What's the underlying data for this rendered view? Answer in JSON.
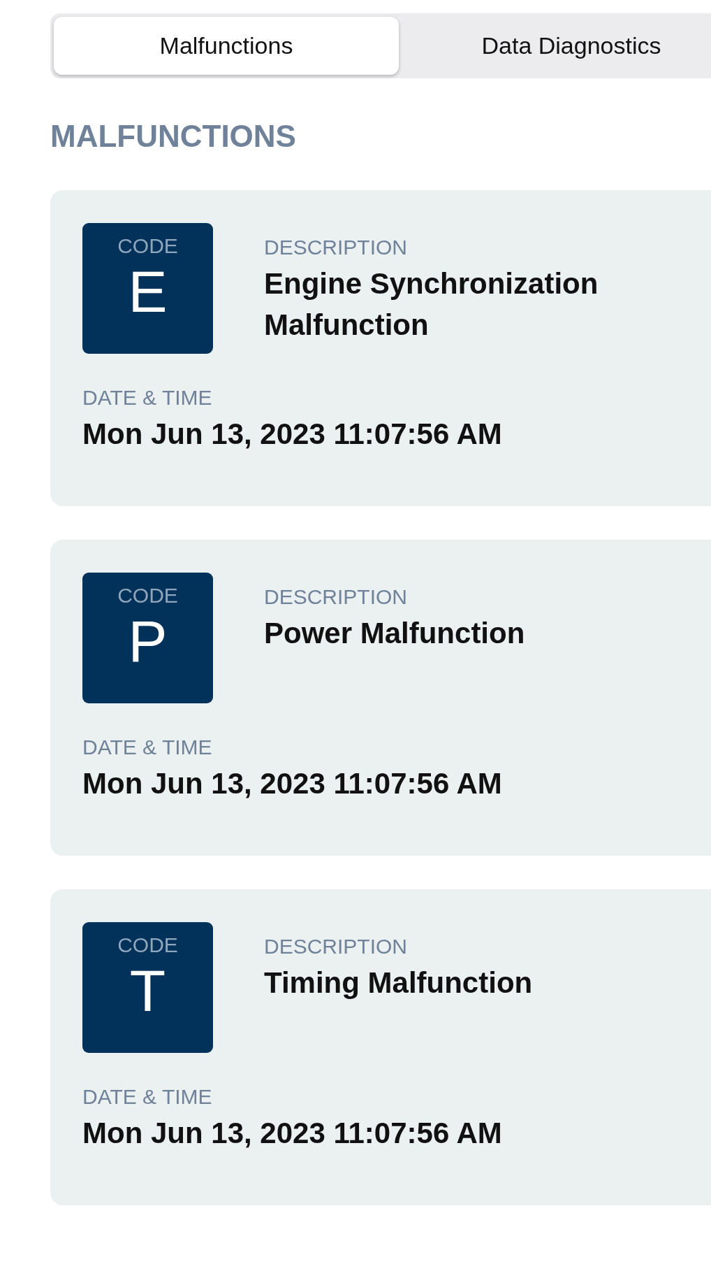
{
  "tabs": [
    {
      "label": "Malfunctions",
      "selected": true
    },
    {
      "label": "Data Diagnostics",
      "selected": false
    }
  ],
  "heading": "MALFUNCTIONS",
  "malfunctions": [
    {
      "code_label": "CODE",
      "code": "E",
      "description_label": "DESCRIPTION",
      "description": "Engine Synchronization Malfunction",
      "datetime_label": "DATE & TIME",
      "datetime": "Mon Jun 13, 2023 11:07:56 AM"
    },
    {
      "code_label": "CODE",
      "code": "P",
      "description_label": "DESCRIPTION",
      "description": "Power Malfunction",
      "datetime_label": "DATE & TIME",
      "datetime": "Mon Jun 13, 2023 11:07:56 AM"
    },
    {
      "code_label": "CODE",
      "code": "T",
      "description_label": "DESCRIPTION",
      "description": "Timing Malfunction",
      "datetime_label": "DATE & TIME",
      "datetime": "Mon Jun 13, 2023 11:07:56 AM"
    }
  ]
}
